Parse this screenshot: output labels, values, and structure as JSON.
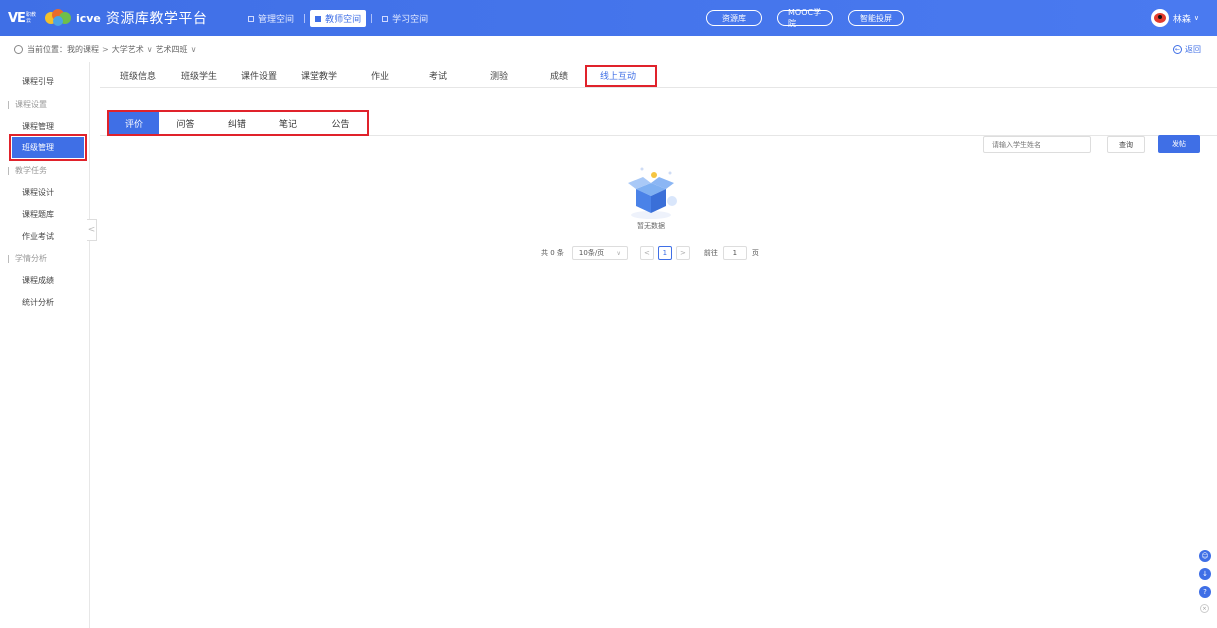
{
  "header": {
    "logo_ve": "VE",
    "logo_ve_sub": "职教云",
    "logo_icve": "icve",
    "app_title": "资源库教学平台",
    "spaces": [
      {
        "label": "管理空间",
        "active": false
      },
      {
        "label": "教师空间",
        "active": true
      },
      {
        "label": "学习空间",
        "active": false
      }
    ],
    "separator": "|",
    "pills": [
      "资源库",
      "MOOC学院",
      "智能投屏"
    ],
    "user_name": "林森",
    "user_chevron": "∨",
    "avatar_icon": "weibo-avatar-icon"
  },
  "breadcrumb": {
    "prefix": "当前位置：",
    "items": [
      "我的课程",
      "大学艺术",
      "艺术四班"
    ],
    "separators": [
      ">",
      "∨",
      "∨"
    ]
  },
  "back_label": "返回",
  "sidebar": {
    "items": [
      {
        "type": "item",
        "label": "课程引导"
      },
      {
        "type": "group",
        "label": "课程设置"
      },
      {
        "type": "item",
        "label": "课程管理"
      },
      {
        "type": "active",
        "label": "班级管理"
      },
      {
        "type": "group",
        "label": "教学任务"
      },
      {
        "type": "item",
        "label": "课程设计"
      },
      {
        "type": "item",
        "label": "课程题库"
      },
      {
        "type": "item",
        "label": "作业考试"
      },
      {
        "type": "group",
        "label": "学情分析"
      },
      {
        "type": "item",
        "label": "课程成绩"
      },
      {
        "type": "item",
        "label": "统计分析"
      }
    ],
    "collapse_glyph": "<"
  },
  "tabs": [
    "班级信息",
    "班级学生",
    "课件设置",
    "课堂教学",
    "作业",
    "考试",
    "测验",
    "成绩",
    "线上互动"
  ],
  "active_tab": "线上互动",
  "subtabs": [
    "评价",
    "问答",
    "纠错",
    "笔记",
    "公告"
  ],
  "active_subtab": "评价",
  "search": {
    "placeholder": "请输入学生姓名"
  },
  "query_label": "查询",
  "post_label": "发帖",
  "empty_text": "暂无数据",
  "pagination": {
    "total": "共 0 条",
    "page_size": "10条/页",
    "current_page": "1",
    "goto_prefix": "前往",
    "goto_value": "1",
    "goto_suffix": "页",
    "prev": "<",
    "next": ">"
  },
  "colors": {
    "accent": "#3f6fe6",
    "highlight_border": "#e0222b"
  }
}
